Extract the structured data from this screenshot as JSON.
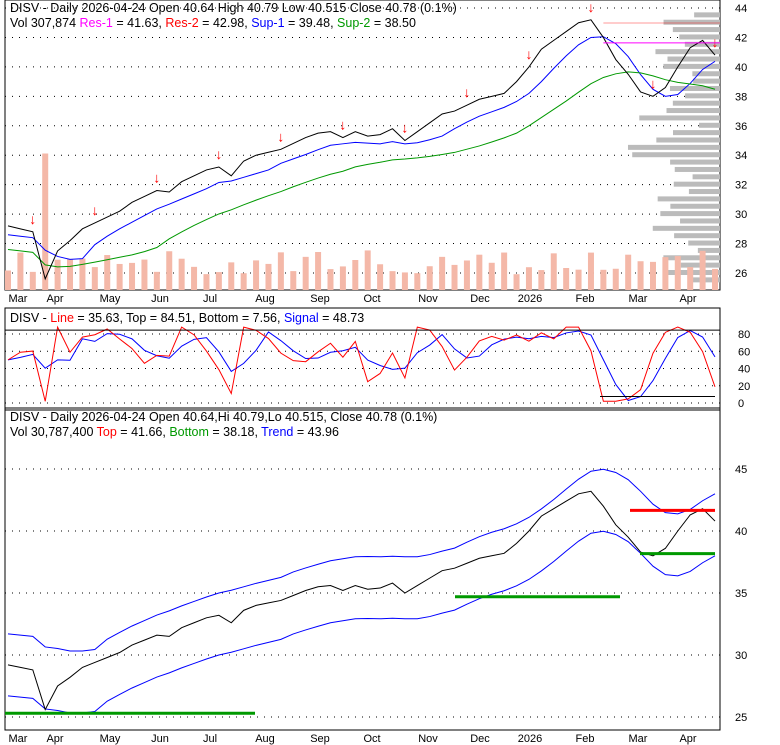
{
  "panel1": {
    "line1": {
      "t": "DISV - Daily 2026-04-24 Open 40.64  High 40.79  Low 40.515  Close 40.78 (0.1%)"
    },
    "vol": "Vol 307,874",
    "res1_label": "Res-1",
    "res1": " = 41.63, ",
    "res2_label": "Res-2",
    "res2": " = 42.98, ",
    "sup1_label": "Sup-1",
    "sup1": " = 39.48, ",
    "sup2_label": "Sup-2",
    "sup2": " = 38.50",
    "yticks": [
      "44",
      "42",
      "40",
      "38",
      "36",
      "34",
      "32",
      "30",
      "28",
      "26"
    ]
  },
  "panel2": {
    "prefix": "DISV - ",
    "line_label": "Line",
    "line": " = 35.63, Top = 84.51, Bottom = 7.56, ",
    "signal_label": "Signal",
    "signal": " = 48.73",
    "yticks": [
      "80",
      "60",
      "40",
      "20",
      "0"
    ]
  },
  "panel3": {
    "line1": "DISV - Daily 2026-04-24 Open 40.64,Hi 40.79,Lo 40.515, Close 40.78 (0.1%)",
    "vol": "Vol 30,787,400 ",
    "top_label": "Top",
    "top": " = 41.66, ",
    "bottom_label": "Bottom",
    "bottom": " = 38.18, ",
    "trend_label": "Trend",
    "trend": " = 43.96",
    "yticks": [
      "45",
      "40",
      "35",
      "30",
      "25"
    ]
  },
  "colors": {
    "res1": "#ff00ff",
    "res2": "#ff0000",
    "sup1": "#0000ff",
    "sup2": "#009900",
    "up": "#008800",
    "down": "#ff0000"
  },
  "chart_data": {
    "type": "line",
    "title": "DISV - Daily",
    "x_labels": [
      "Mar",
      "Apr",
      "May",
      "Jun",
      "Jul",
      "Aug",
      "Sep",
      "Oct",
      "Nov",
      "Dec",
      "2026",
      "Feb",
      "Mar",
      "Apr"
    ],
    "weekly_close": [
      29.2,
      29,
      28.8,
      25.6,
      27.5,
      28.2,
      29,
      29.4,
      29.8,
      30.2,
      30.8,
      31.2,
      31.6,
      31.5,
      32.2,
      32.6,
      33,
      33.2,
      32.6,
      33.6,
      34,
      34.2,
      34.4,
      34.8,
      35.2,
      35.5,
      35.6,
      35.2,
      35.6,
      35.3,
      35.4,
      35.8,
      35,
      35.6,
      36.2,
      36.8,
      37,
      37.4,
      37.8,
      38,
      38.2,
      39,
      40,
      41.2,
      41.8,
      42.4,
      43,
      43.2,
      42,
      40.5,
      39.5,
      38.3,
      38,
      38.6,
      40,
      41.3,
      41.8,
      40.8
    ],
    "ylim_price": [
      25,
      44.5
    ],
    "ylim_osc": [
      0,
      90
    ]
  }
}
